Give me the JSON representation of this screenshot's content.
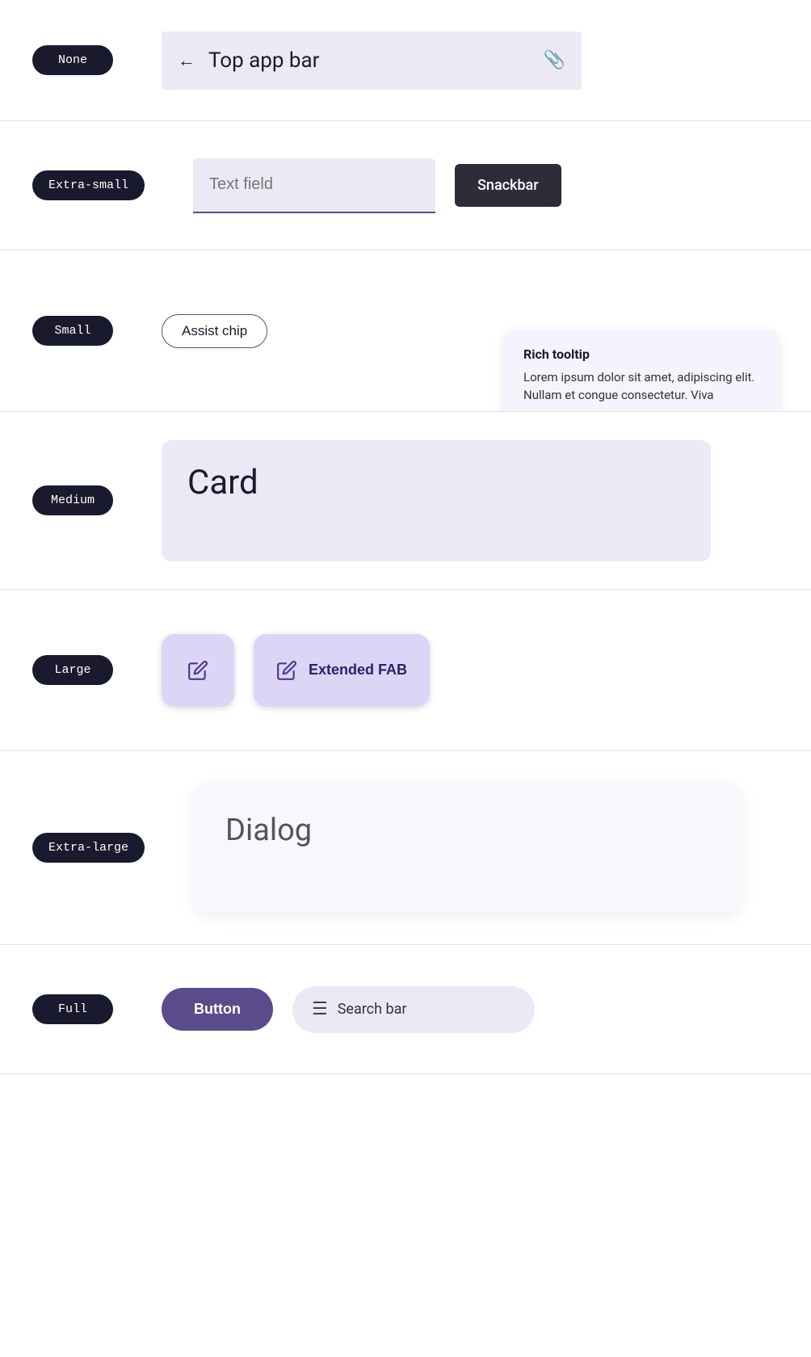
{
  "rows": [
    {
      "id": "none",
      "badge_label": "None",
      "content_type": "top_app_bar",
      "top_app_bar": {
        "title": "Top app bar",
        "back_icon": "←",
        "attach_icon": "📎"
      }
    },
    {
      "id": "extrasmall",
      "badge_label": "Extra-small",
      "content_type": "text_field_snackbar",
      "text_field": {
        "placeholder": "Text field"
      },
      "snackbar": {
        "label": "Snackbar"
      }
    },
    {
      "id": "small",
      "badge_label": "Small",
      "content_type": "assist_chip_tooltip",
      "assist_chip": {
        "label": "Assist chip"
      },
      "rich_tooltip": {
        "title": "Rich tooltip",
        "body": "Lorem ipsum dolor sit amet, adipiscing elit. Nullam et congue consectetur. Viva"
      }
    },
    {
      "id": "medium",
      "badge_label": "Medium",
      "content_type": "card",
      "card": {
        "title": "Card"
      }
    },
    {
      "id": "large",
      "badge_label": "Large",
      "content_type": "fab",
      "extended_fab": {
        "label": "Extended FAB"
      }
    },
    {
      "id": "extralarge",
      "badge_label": "Extra-large",
      "content_type": "dialog",
      "dialog": {
        "title": "Dialog"
      }
    },
    {
      "id": "full",
      "badge_label": "Full",
      "content_type": "button_searchbar",
      "button": {
        "label": "Button"
      },
      "search_bar": {
        "label": "Search bar",
        "menu_icon": "☰"
      }
    }
  ]
}
